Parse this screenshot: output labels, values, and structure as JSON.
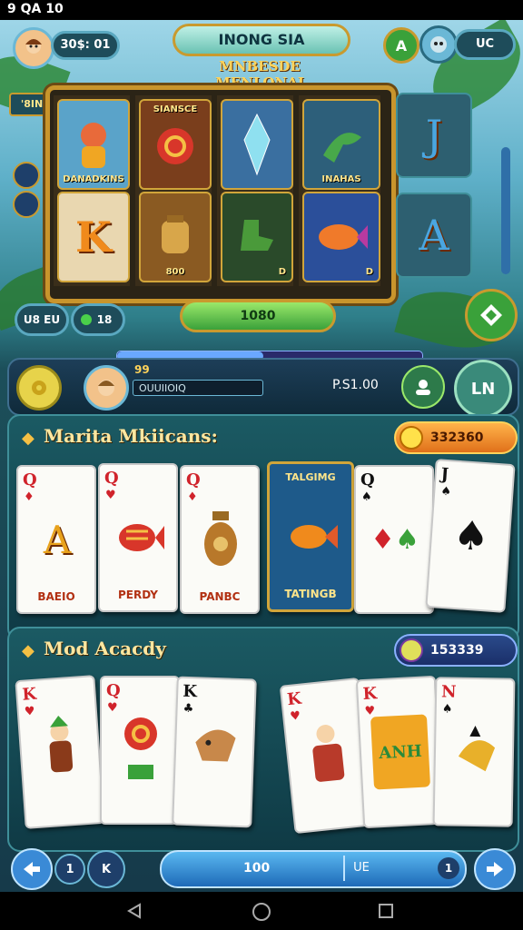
{
  "status_bar": {
    "time": "9 QA 10"
  },
  "header": {
    "player_level": "30$: 01",
    "title_plate": "INONG SIA",
    "subtitle": "MNBESDE MENLONAI",
    "badge_a": "A",
    "pill_right": "UC",
    "side_label": "'8IN"
  },
  "slot": {
    "symbols": [
      {
        "caption": "DANADKINS"
      },
      {
        "caption": "SIANSCE"
      },
      {
        "caption": ""
      },
      {
        "caption": "INAHAS"
      },
      {
        "caption": ""
      },
      {
        "caption": "800"
      },
      {
        "caption": "D"
      },
      {
        "caption": "D"
      }
    ],
    "bet_a": "U8 EU",
    "bet_b": "18",
    "spin_value": "1080",
    "side_cards": [
      "J",
      "A"
    ]
  },
  "player_bar": {
    "score_top": "99",
    "name": "OUUIIOIQ",
    "credits": "P.S1.00",
    "right_button": "LN"
  },
  "section1": {
    "title": "Marita Mkiicans:",
    "coins": "332360",
    "cards": [
      {
        "rank": "Q",
        "art": "A",
        "label": "BAEIO"
      },
      {
        "rank": "Q",
        "art": "fish",
        "label": "PERDY"
      },
      {
        "rank": "Q",
        "art": "vase",
        "label": "PANBC"
      },
      {
        "rank": "",
        "art": "fish",
        "label": "TATINGB"
      },
      {
        "rank": "Q",
        "art": "",
        "label": ""
      },
      {
        "rank": "J",
        "art": "",
        "label": ""
      }
    ],
    "feature_card_label": "TALGIMG"
  },
  "section2": {
    "title": "Mod Acacdy",
    "coins": "153339",
    "cards": [
      {
        "rank": "K"
      },
      {
        "rank": "Q"
      },
      {
        "rank": "K"
      },
      {
        "rank": "K"
      },
      {
        "rank": "K"
      },
      {
        "rank": "N"
      }
    ],
    "feature_text": "ANH"
  },
  "bottom": {
    "page": "1",
    "page_b": "K",
    "bar_value": "100",
    "bar_tag": "UE",
    "bar_count": "1"
  },
  "colors": {
    "gold": "#c99a2e",
    "teal": "#1b5a63",
    "green": "#3aa13a",
    "orange": "#f08a1c"
  }
}
